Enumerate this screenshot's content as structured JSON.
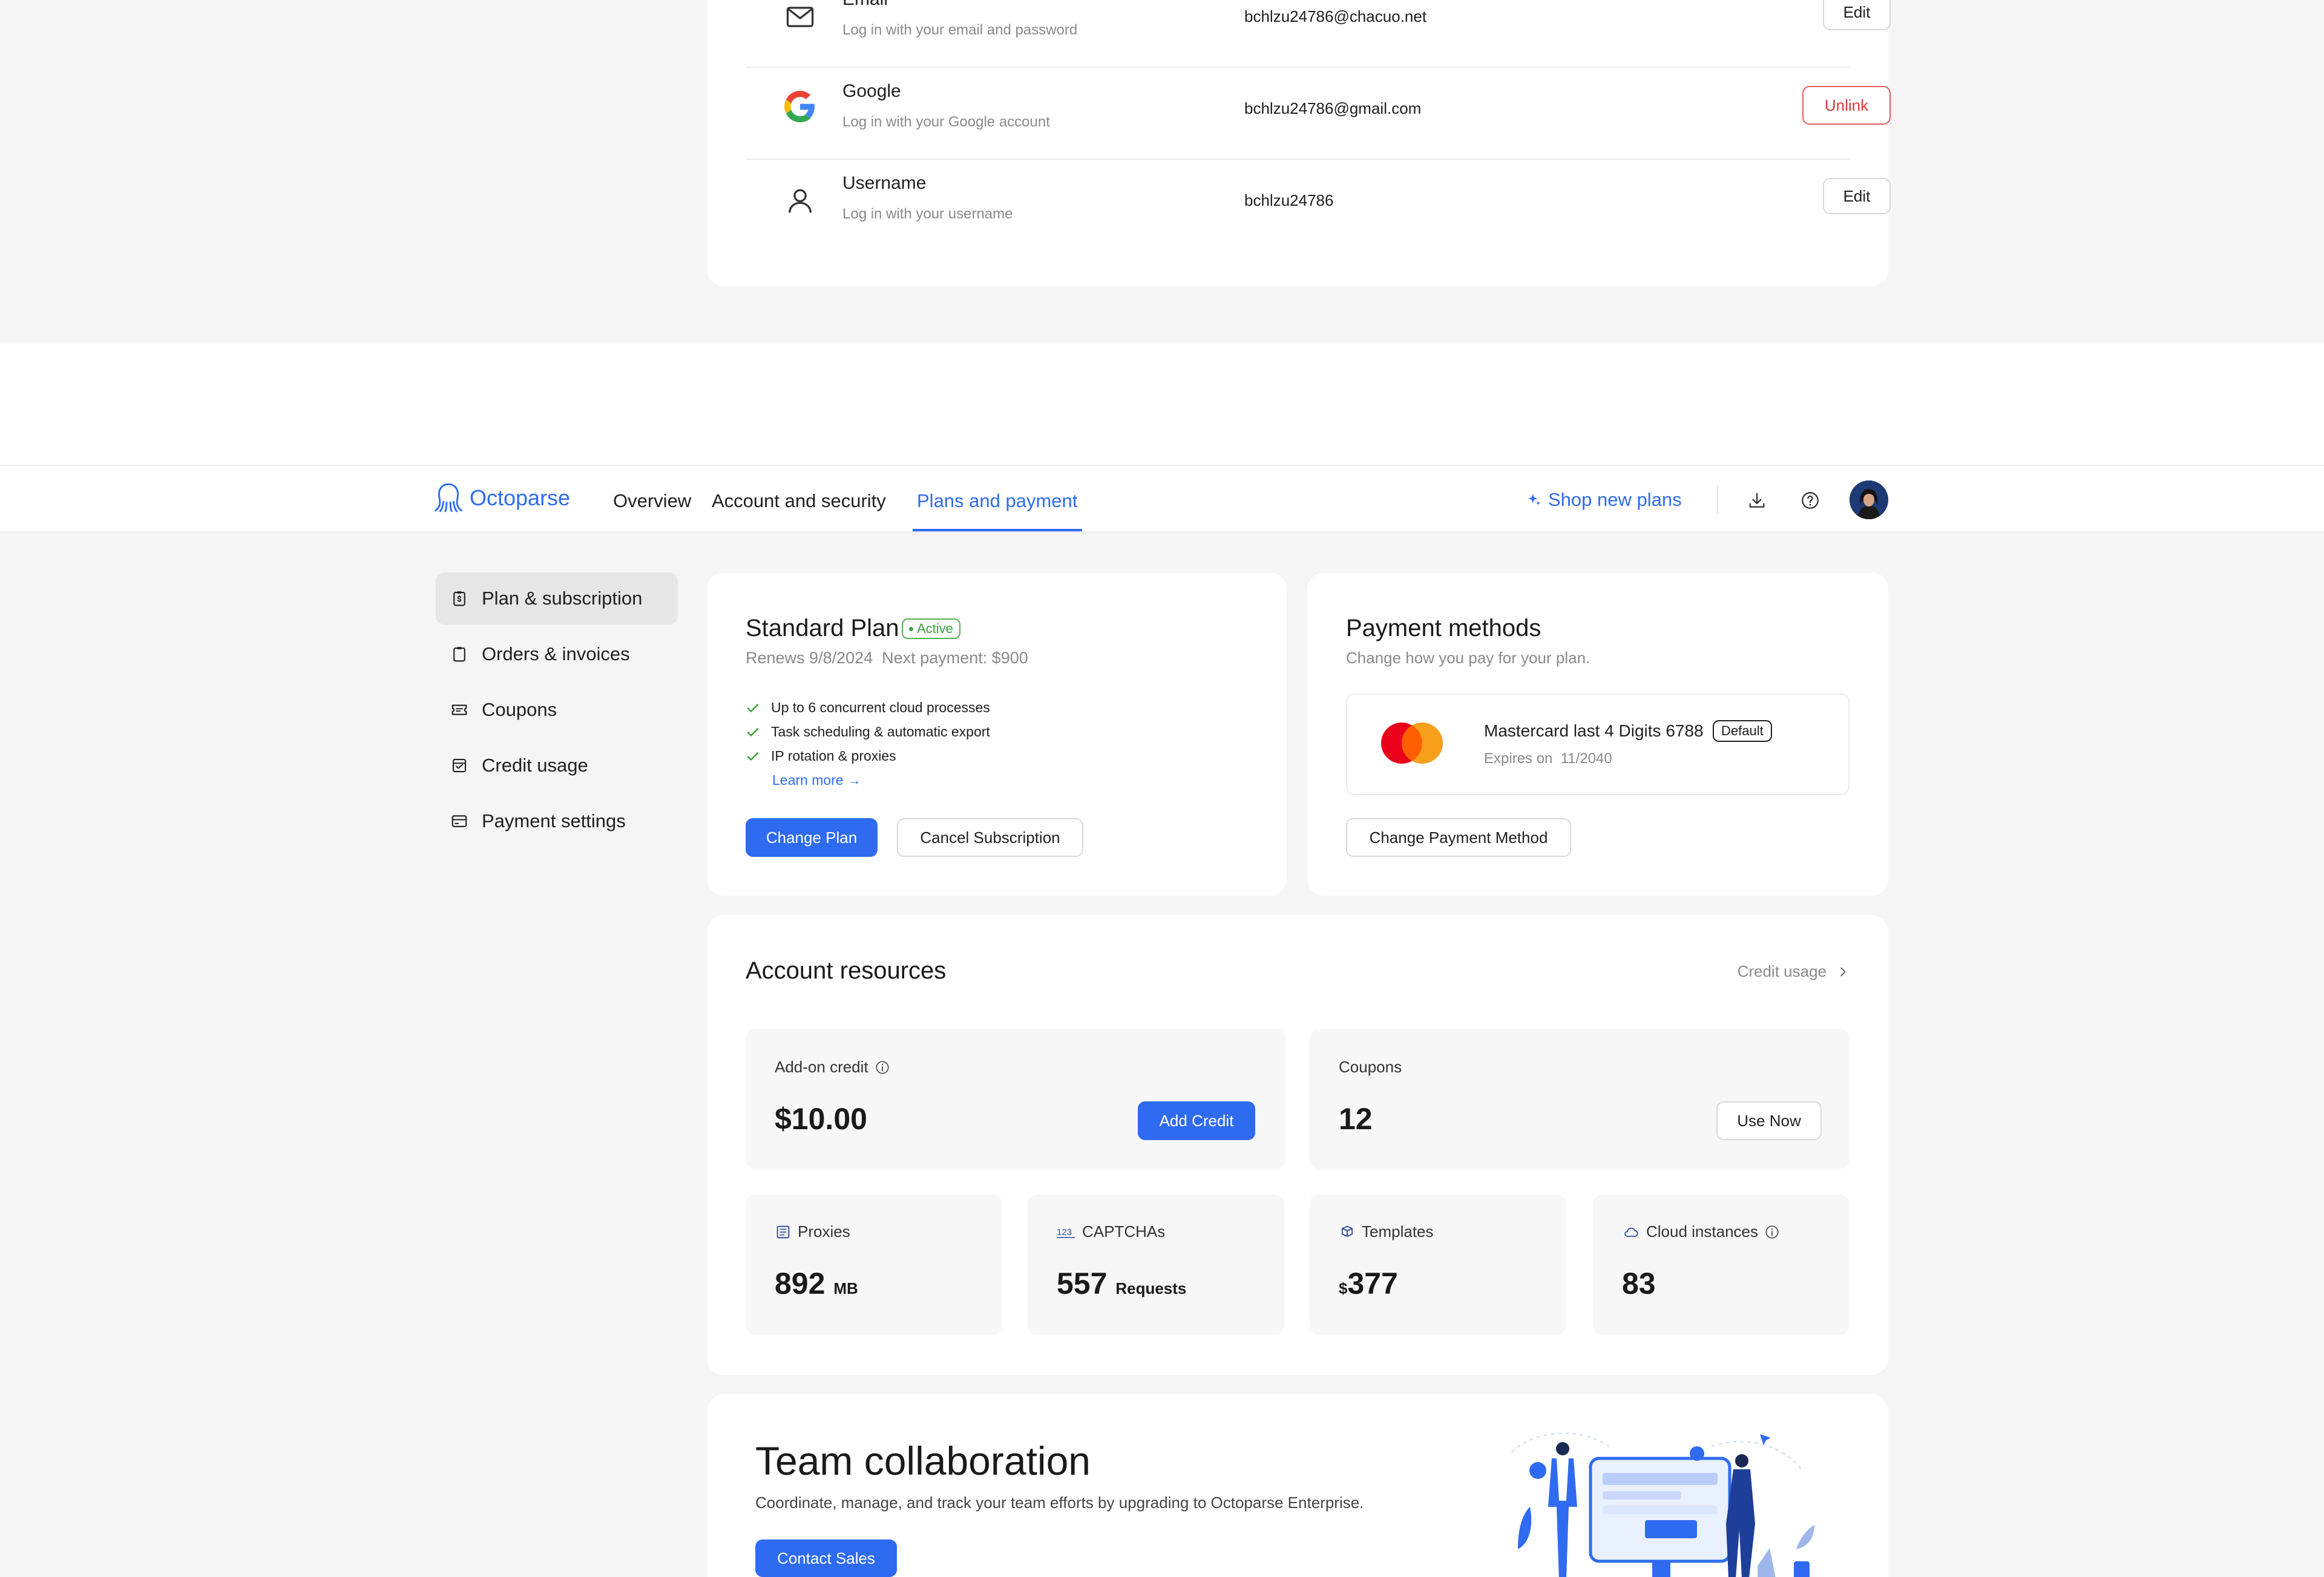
{
  "login_methods": [
    {
      "icon": "mail-icon",
      "title": "Email",
      "subtitle": "Log in with your email and password",
      "value": "bchlzu24786@chacuo.net",
      "action": "Edit",
      "danger": false
    },
    {
      "icon": "google-icon",
      "title": "Google",
      "subtitle": "Log in with your Google account",
      "value": "bchlzu24786@gmail.com",
      "action": "Unlink",
      "danger": true
    },
    {
      "icon": "user-icon",
      "title": "Username",
      "subtitle": "Log in with your username",
      "value": "bchlzu24786",
      "action": "Edit",
      "danger": false
    }
  ],
  "nav": {
    "brand": "Octoparse",
    "tabs": [
      "Overview",
      "Account and security",
      "Plans and payment"
    ],
    "active_tab": "Plans and payment",
    "shop_label": "Shop new plans"
  },
  "sidebar": {
    "items": [
      {
        "label": "Plan & subscription",
        "icon": "clipboard-dollar-icon"
      },
      {
        "label": "Orders & invoices",
        "icon": "clipboard-icon"
      },
      {
        "label": "Coupons",
        "icon": "ticket-icon"
      },
      {
        "label": "Credit usage",
        "icon": "calendar-credit-icon"
      },
      {
        "label": "Payment settings",
        "icon": "card-icon"
      }
    ],
    "active_index": 0
  },
  "plan": {
    "name": "Standard Plan",
    "status": "Active",
    "renews": "Renews 9/8/2024",
    "next_payment": "Next payment: $900",
    "features": [
      "Up to 6 concurrent cloud processes",
      "Task scheduling & automatic export",
      "IP rotation & proxies"
    ],
    "learn_more": "Learn more →",
    "change_label": "Change Plan",
    "cancel_label": "Cancel Subscription"
  },
  "payment": {
    "title": "Payment methods",
    "subtitle": "Change how you pay for your plan.",
    "card_name": "Mastercard last 4 Digits 6788",
    "default_badge": "Default",
    "expires_label": "Expires on",
    "expires_value": "11/2040",
    "change_label": "Change Payment Method"
  },
  "resources": {
    "title": "Account resources",
    "credit_usage_link": "Credit usage",
    "addon_label": "Add-on credit",
    "addon_value": "$10.00",
    "add_credit_label": "Add Credit",
    "coupons_label": "Coupons",
    "coupons_value": "12",
    "use_now_label": "Use Now",
    "stats": [
      {
        "label": "Proxies",
        "value": "892",
        "unit": "MB",
        "prefix": "",
        "icon": "proxy-icon",
        "info": false
      },
      {
        "label": "CAPTCHAs",
        "value": "557",
        "unit": "Requests",
        "prefix": "",
        "icon": "captcha-123-icon",
        "info": false
      },
      {
        "label": "Templates",
        "value": "377",
        "unit": "",
        "prefix": "$",
        "icon": "template-icon",
        "info": false
      },
      {
        "label": "Cloud instances",
        "value": "83",
        "unit": "",
        "prefix": "",
        "icon": "cloud-icon",
        "info": true
      }
    ]
  },
  "team": {
    "title": "Team collaboration",
    "subtitle": "Coordinate, manage, and track your team efforts by upgrading to Octoparse Enterprise.",
    "cta": "Contact Sales"
  },
  "colors": {
    "accent": "#2f6bf0",
    "success": "#3ca13c",
    "danger": "#d93a3a",
    "background": "#f5f5f5"
  }
}
